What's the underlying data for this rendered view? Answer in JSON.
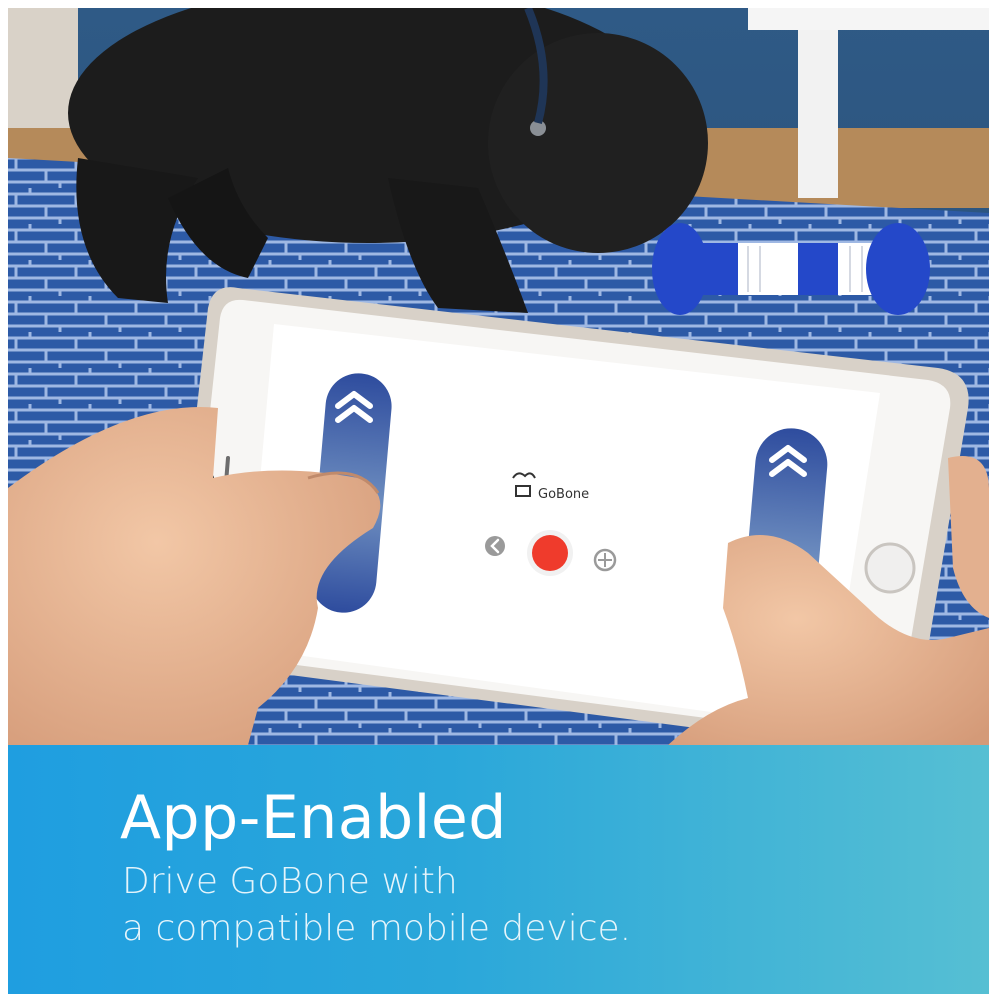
{
  "app": {
    "logo_text": "GoBone"
  },
  "banner": {
    "headline": "App-Enabled",
    "line1": "Drive GoBone with",
    "line2": "a compatible mobile device."
  },
  "colors": {
    "banner_start": "#1f9ee0",
    "banner_end": "#56bfd3",
    "control_blue": "#2e4c9e",
    "record_red": "#ef3b2c",
    "bone_blue": "#2448c9"
  },
  "icons": {
    "left_stick_up": "chevron-double-up-icon",
    "right_stick_up": "chevron-double-up-icon",
    "right_stick_down": "chevron-double-down-icon",
    "back": "back-arrow-icon",
    "record": "record-button",
    "settings": "crosshair-icon"
  }
}
